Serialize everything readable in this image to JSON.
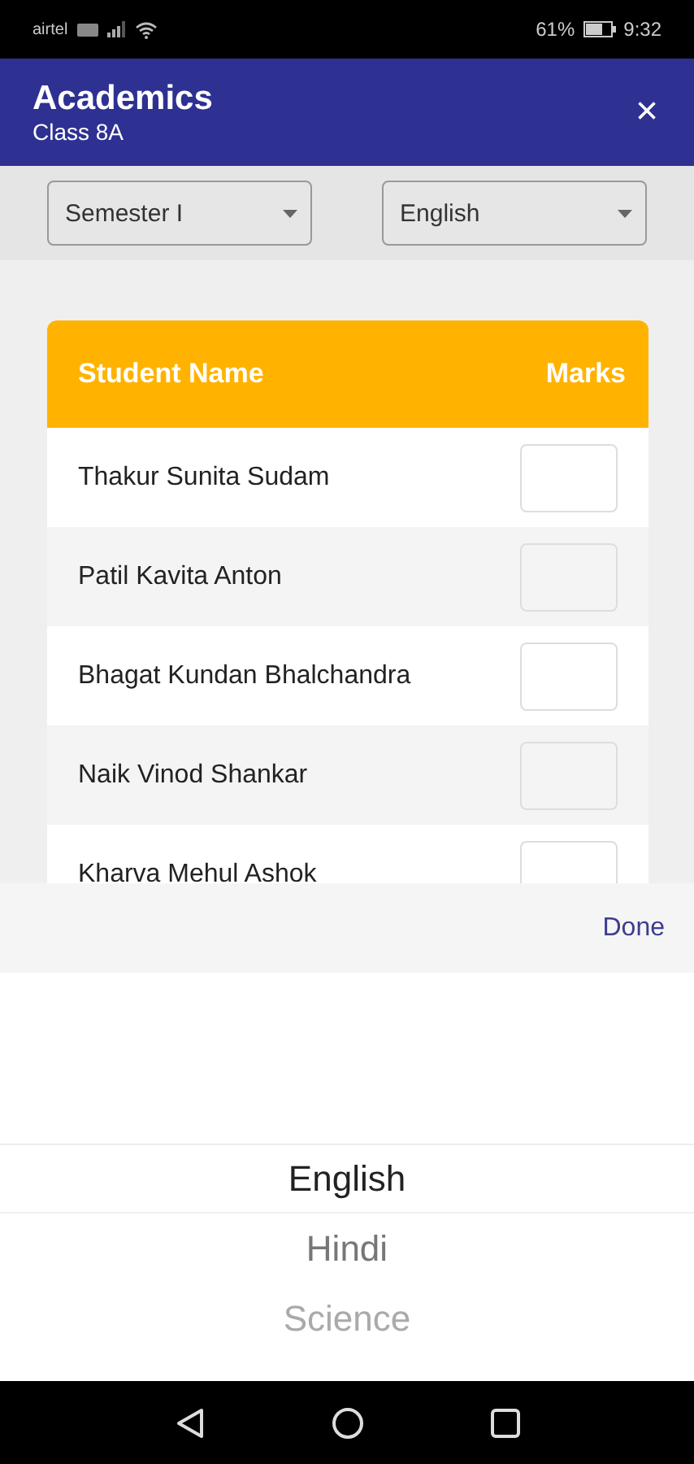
{
  "status_bar": {
    "carrier": "airtel",
    "battery": "61%",
    "time": "9:32"
  },
  "header": {
    "title": "Academics",
    "subtitle": "Class 8A",
    "close": "×"
  },
  "filters": [
    {
      "value": "Semester I"
    },
    {
      "value": "English"
    }
  ],
  "table": {
    "columns": [
      "Student Name",
      "Marks"
    ],
    "rows": [
      {
        "name": "Thakur Sunita Sudam"
      },
      {
        "name": "Patil Kavita Anton"
      },
      {
        "name": "Bhagat Kundan Bhalchandra"
      },
      {
        "name": "Naik Vinod Shankar"
      },
      {
        "name": "Kharva Mehul Ashok"
      }
    ]
  },
  "picker": {
    "done": "Done",
    "options": [
      {
        "label": "English",
        "selected": true
      },
      {
        "label": "Hindi",
        "selected": false
      },
      {
        "label": "Science",
        "selected": false
      }
    ]
  }
}
